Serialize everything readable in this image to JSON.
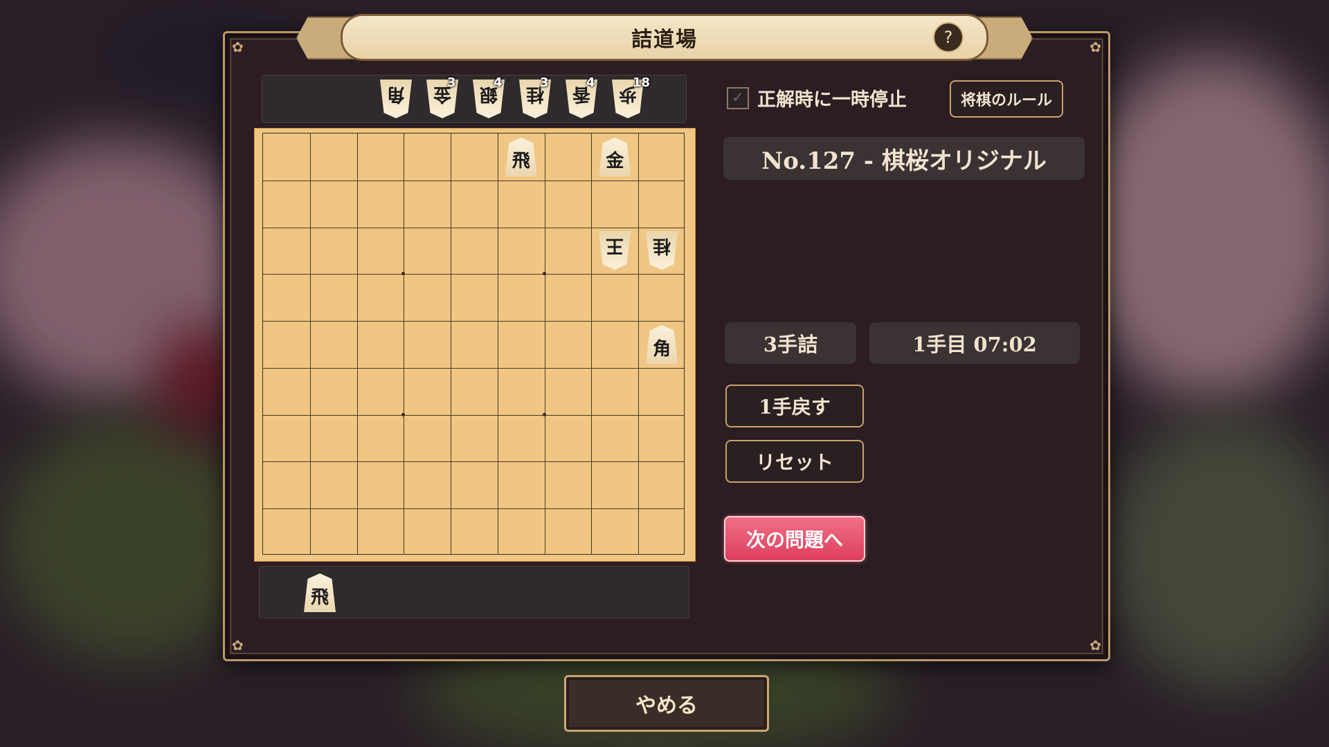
{
  "title": "詰道場",
  "help_label": "?",
  "pause_option": {
    "label": "正解時に一時停止",
    "checked": true,
    "check_glyph": "✓"
  },
  "rules_button": "将棋のルール",
  "puzzle_name": "No.127 - 棋桜オリジナル",
  "mate_length": "3手詰",
  "move_status": "1手目 07:02",
  "buttons": {
    "undo": "1手戻す",
    "reset": "リセット",
    "next": "次の問題へ",
    "quit": "やめる"
  },
  "opponent_hand": [
    {
      "piece": "角",
      "count": ""
    },
    {
      "piece": "金",
      "count": "3"
    },
    {
      "piece": "銀",
      "count": "4"
    },
    {
      "piece": "桂",
      "count": "3"
    },
    {
      "piece": "香",
      "count": "4"
    },
    {
      "piece": "歩",
      "count": "18"
    }
  ],
  "player_hand": [
    {
      "piece": "飛",
      "count": ""
    }
  ],
  "board": [
    {
      "file": 4,
      "rank": 1,
      "piece": "飛",
      "owner": "sente"
    },
    {
      "file": 2,
      "rank": 1,
      "piece": "金",
      "owner": "sente"
    },
    {
      "file": 2,
      "rank": 3,
      "piece": "王",
      "owner": "gote"
    },
    {
      "file": 1,
      "rank": 3,
      "piece": "桂",
      "owner": "gote"
    },
    {
      "file": 1,
      "rank": 5,
      "piece": "角",
      "owner": "sente"
    }
  ],
  "colors": {
    "board": "#f0c684",
    "accent": "#c8a46a",
    "next_button": "#e4506c"
  }
}
